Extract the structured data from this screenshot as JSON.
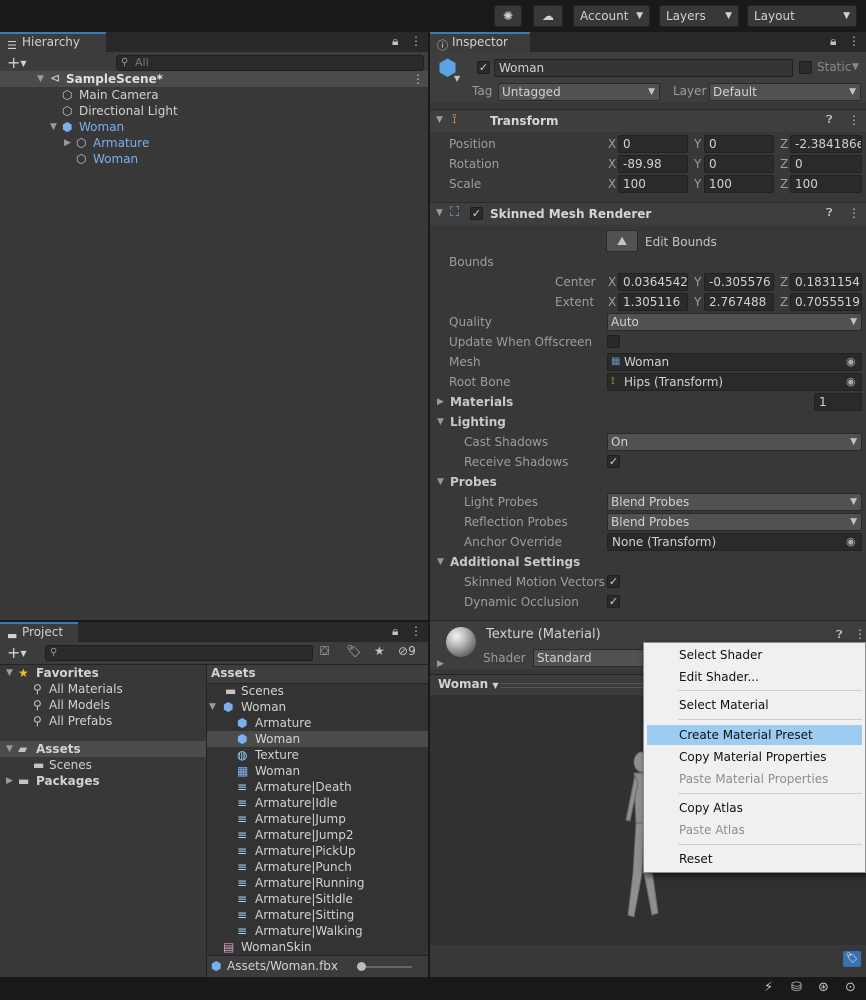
{
  "toolbar": {
    "account": "Account",
    "layers": "Layers",
    "layout": "Layout"
  },
  "hierarchy": {
    "tab": "Hierarchy",
    "search_placeholder": "All",
    "items": [
      {
        "label": "SampleScene*"
      },
      {
        "label": "Main Camera"
      },
      {
        "label": "Directional Light"
      },
      {
        "label": "Woman"
      },
      {
        "label": "Armature"
      },
      {
        "label": "Woman"
      }
    ]
  },
  "inspector": {
    "tab": "Inspector",
    "object_name": "Woman",
    "static_label": "Static",
    "tag_label": "Tag",
    "tag_value": "Untagged",
    "layer_label": "Layer",
    "layer_value": "Default",
    "transform": {
      "title": "Transform",
      "position_label": "Position",
      "rotation_label": "Rotation",
      "scale_label": "Scale",
      "position": [
        "0",
        "0",
        "-2.384186e"
      ],
      "rotation": [
        "-89.98",
        "0",
        "0"
      ],
      "scale": [
        "100",
        "100",
        "100"
      ]
    },
    "axes": [
      "X",
      "Y",
      "Z"
    ],
    "smr": {
      "title": "Skinned Mesh Renderer",
      "edit_bounds": "Edit Bounds",
      "bounds_label": "Bounds",
      "center_label": "Center",
      "extent_label": "Extent",
      "center": [
        "0.0364542",
        "-0.305576",
        "0.1831154"
      ],
      "extent": [
        "1.305116",
        "2.767488",
        "0.7055519"
      ],
      "quality_label": "Quality",
      "quality_value": "Auto",
      "update_offscreen_label": "Update When Offscreen",
      "mesh_label": "Mesh",
      "mesh_value": "Woman",
      "root_bone_label": "Root Bone",
      "root_bone_value": "Hips (Transform)",
      "materials_label": "Materials",
      "materials_count": "1",
      "lighting_label": "Lighting",
      "cast_shadows_label": "Cast Shadows",
      "cast_shadows_value": "On",
      "receive_shadows_label": "Receive Shadows",
      "probes_label": "Probes",
      "light_probes_label": "Light Probes",
      "light_probes_value": "Blend Probes",
      "reflection_probes_label": "Reflection Probes",
      "reflection_probes_value": "Blend Probes",
      "anchor_override_label": "Anchor Override",
      "anchor_override_value": "None (Transform)",
      "additional_label": "Additional Settings",
      "skinned_motion_label": "Skinned Motion Vectors",
      "dynamic_occlusion_label": "Dynamic Occlusion"
    },
    "material": {
      "title": "Texture (Material)",
      "shader_label": "Shader",
      "shader_value": "Standard"
    },
    "preview": {
      "dropdown": "Woman"
    }
  },
  "project": {
    "tab": "Project",
    "hidden_count": "9",
    "favorites": {
      "label": "Favorites",
      "items": [
        "All Materials",
        "All Models",
        "All Prefabs"
      ]
    },
    "assets_label": "Assets",
    "assets_children": [
      "Scenes"
    ],
    "packages_label": "Packages",
    "right_header": "Assets",
    "files": [
      {
        "label": "Scenes"
      },
      {
        "label": "Woman"
      },
      {
        "label": "Armature"
      },
      {
        "label": "Woman"
      },
      {
        "label": "Texture"
      },
      {
        "label": "Woman"
      },
      {
        "label": "Armature|Death"
      },
      {
        "label": "Armature|Idle"
      },
      {
        "label": "Armature|Jump"
      },
      {
        "label": "Armature|Jump2"
      },
      {
        "label": "Armature|PickUp"
      },
      {
        "label": "Armature|Punch"
      },
      {
        "label": "Armature|Running"
      },
      {
        "label": "Armature|SitIdle"
      },
      {
        "label": "Armature|Sitting"
      },
      {
        "label": "Armature|Walking"
      },
      {
        "label": "WomanSkin"
      }
    ],
    "path": "Assets/Woman.fbx"
  },
  "context_menu": {
    "items": [
      {
        "label": "Select Shader"
      },
      {
        "label": "Edit Shader..."
      },
      {
        "label": "Select Material"
      },
      {
        "label": "Create Material Preset"
      },
      {
        "label": "Copy Material Properties"
      },
      {
        "label": "Paste Material Properties"
      },
      {
        "label": "Copy Atlas"
      },
      {
        "label": "Paste Atlas"
      },
      {
        "label": "Reset"
      }
    ]
  },
  "colors": {
    "accent": "#3a79bb",
    "selection": "#2c5d87",
    "menu_highlight": "#9cccf2",
    "link_blue": "#7ab0f0"
  }
}
